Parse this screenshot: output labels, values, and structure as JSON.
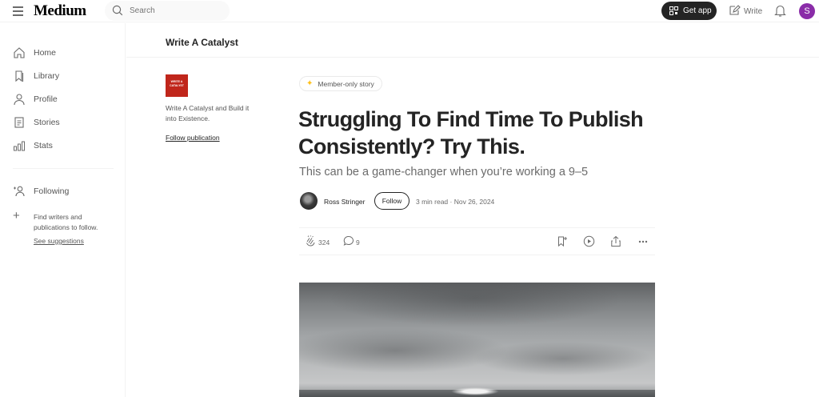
{
  "header": {
    "logo": "Medium",
    "search_placeholder": "Search",
    "get_app_label": "Get app",
    "write_label": "Write",
    "avatar_initial": "S",
    "avatar_color": "#8a2ca8"
  },
  "sidebar": {
    "items": [
      {
        "label": "Home",
        "icon": "home-icon"
      },
      {
        "label": "Library",
        "icon": "bookmark-icon"
      },
      {
        "label": "Profile",
        "icon": "user-icon"
      },
      {
        "label": "Stories",
        "icon": "document-icon"
      },
      {
        "label": "Stats",
        "icon": "bar-chart-icon"
      }
    ],
    "following_label": "Following",
    "find_writers_text": "Find writers and publications to follow.",
    "see_suggestions_label": "See suggestions"
  },
  "publication": {
    "name": "Write A Catalyst",
    "logo_text": "WRITE A CATALYST",
    "description": "Write A Catalyst and Build it into Existence.",
    "follow_link": "Follow publication",
    "logo_color": "#c0261b"
  },
  "article": {
    "badge": "Member-only story",
    "title": "Struggling To Find Time To Publish Consistently? Try This.",
    "subtitle": "This can be a game-changer when you’re working a 9–5",
    "author": "Ross Stringer",
    "follow_label": "Follow",
    "meta": "3 min read  ·  Nov 26, 2024",
    "claps": "324",
    "responses": "9",
    "badge_star_color": "#ffc017"
  }
}
